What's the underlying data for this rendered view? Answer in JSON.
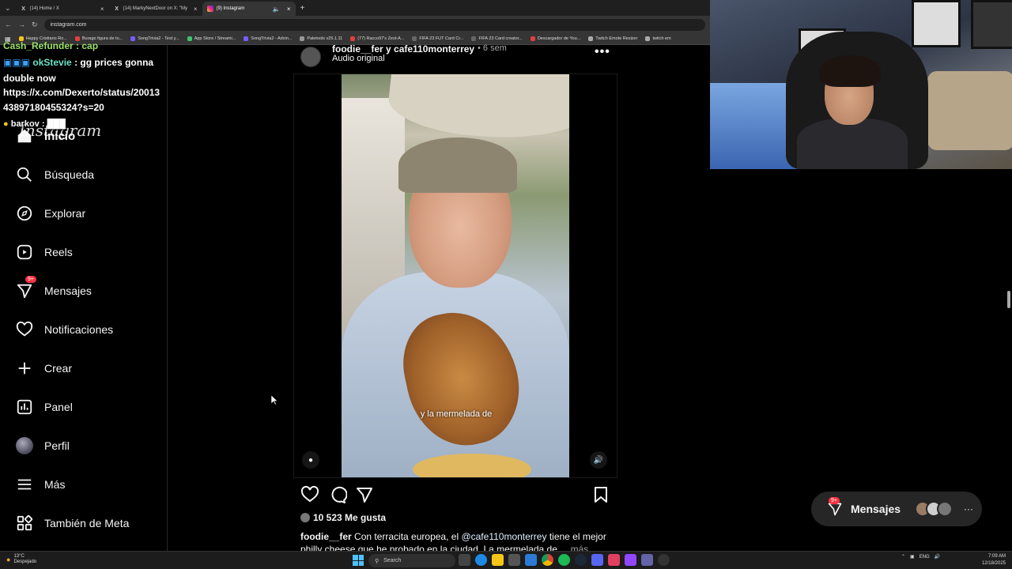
{
  "browser": {
    "tabs": [
      {
        "label": "(14) Home / X",
        "icon": "x-logo-icon"
      },
      {
        "label": "(14) MarkyNextDoor on X: \"My",
        "icon": "x-logo-icon"
      },
      {
        "label": "(9) Instagram",
        "icon": "instagram-icon"
      }
    ],
    "url": "instagram.com",
    "bookmarks": [
      "Happy Cristiano Ro...",
      "Burago figura de to...",
      "SongTrivia2 - Test y...",
      "App Store / Streami...",
      "SongTrivia2 - Advin...",
      "Paletools v25.1.11",
      "(77) Racco97's Zest-A...",
      "FIFA 23 FUT Card Cr...",
      "FIFA 23 Card creator...",
      "Descargador de You...",
      "Twitch Emote Resizer",
      "twitch em"
    ]
  },
  "chat": {
    "line1": "Cash_Refunder : cap",
    "line2_user": "okStevie",
    "line2_msg": ": gg prices gonna",
    "line3": "double now",
    "line4": "https://x.com/Dexerto/status/20013",
    "line5": "43897180455324?s=20",
    "line6": "barkov : ███"
  },
  "sidebar": {
    "watermark": "Instagram",
    "items": [
      {
        "label": "Inicio",
        "icon": "home-icon"
      },
      {
        "label": "Búsqueda",
        "icon": "search-icon"
      },
      {
        "label": "Explorar",
        "icon": "compass-icon"
      },
      {
        "label": "Reels",
        "icon": "reels-icon"
      },
      {
        "label": "Mensajes",
        "icon": "messenger-icon",
        "badge": "9+"
      },
      {
        "label": "Notificaciones",
        "icon": "heart-icon"
      },
      {
        "label": "Crear",
        "icon": "plus-icon"
      },
      {
        "label": "Panel",
        "icon": "chart-icon"
      },
      {
        "label": "Perfil",
        "icon": "avatar"
      },
      {
        "label": "Más",
        "icon": "menu-icon"
      },
      {
        "label": "También de Meta",
        "icon": "meta-grid-icon"
      }
    ]
  },
  "post": {
    "user": "foodie__fer y cafe110monterrey",
    "time": "• 6 sem",
    "audio": "Audio original",
    "video_caption": "y la mermelada de",
    "likes": "10 523 Me gusta",
    "desc_user": "foodie__fer",
    "desc_text1": "Con terracita europea, el",
    "desc_mention": "@cafe110monterrey",
    "desc_text2": "tiene el mejor philly cheese que he probado en la ciudad. La mermelada de ...",
    "desc_more": "más"
  },
  "messages_pill": {
    "label": "Mensajes",
    "badge": "9+"
  },
  "taskbar": {
    "temp": "13°C",
    "weather": "Despejado",
    "search": "Search",
    "lang": "ENG",
    "time": "7:09 AM",
    "date": "12/18/2025"
  },
  "colors": {
    "badge": "#ff3040",
    "background": "#000000",
    "mention": "#e0f1ff"
  }
}
